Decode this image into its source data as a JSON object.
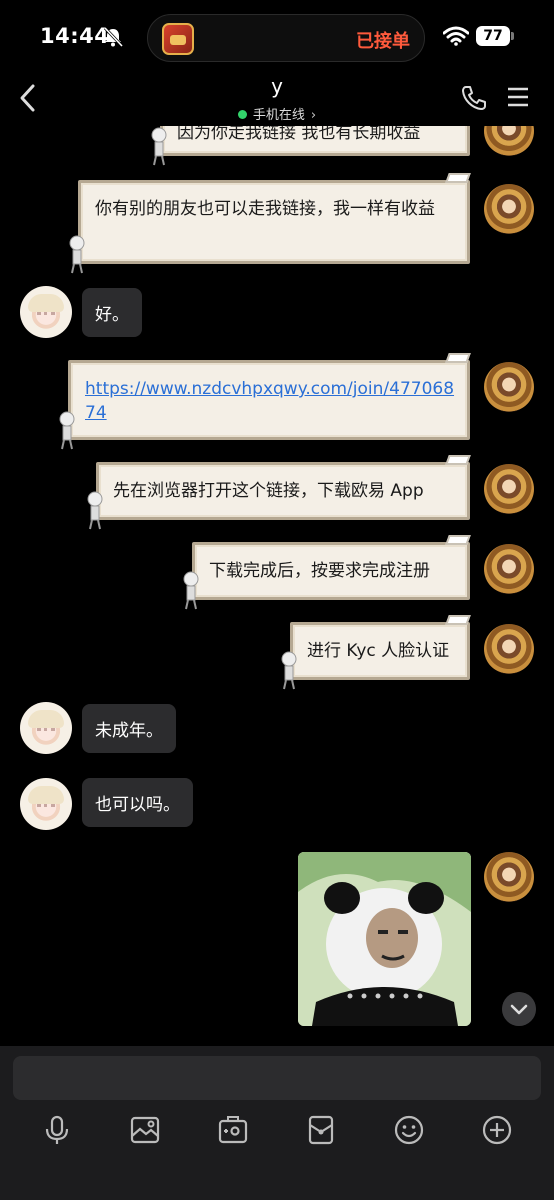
{
  "status_bar": {
    "time": "14:44",
    "island_text": "已接单",
    "battery": "77"
  },
  "header": {
    "title": "y",
    "presence": "手机在线"
  },
  "messages": [
    {
      "from": "me",
      "text": "因为你走我链接 我也有长期收益"
    },
    {
      "from": "me",
      "text": "你有别的朋友也可以走我链接，我一样有收益"
    },
    {
      "from": "other",
      "text": "好。"
    },
    {
      "from": "me",
      "text": "https://www.nzdcvhpxqwy.com/join/47706874",
      "is_link": true
    },
    {
      "from": "me",
      "text": "先在浏览器打开这个链接，下载欧易 App"
    },
    {
      "from": "me",
      "text": "下载完成后，按要求完成注册"
    },
    {
      "from": "me",
      "text": "进行 Kyc 人脸认证"
    },
    {
      "from": "other",
      "text": "未成年。"
    },
    {
      "from": "other",
      "text": "也可以吗。"
    },
    {
      "from": "me",
      "type": "sticker",
      "sticker": "panda-meme-sticker"
    }
  ],
  "toolbar": {
    "icons": [
      "microphone-icon",
      "image-icon",
      "camera-icon",
      "red-packet-icon",
      "emoji-icon",
      "plus-icon"
    ]
  },
  "colors": {
    "presence_dot": "#33d36b",
    "island_text": "#ff5a3c",
    "link": "#2a6fd6"
  }
}
